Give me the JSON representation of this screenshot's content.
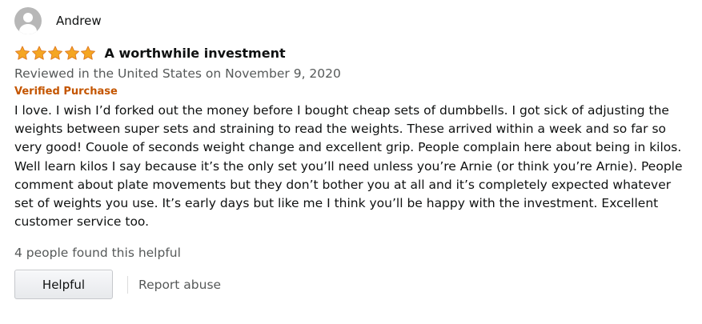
{
  "profile": {
    "name": "Andrew"
  },
  "review": {
    "rating": 5,
    "max_rating": 5,
    "star_color": "#f5a623",
    "title": "A worthwhile investment",
    "date": "Reviewed in the United States on November 9, 2020",
    "verified_label": "Verified Purchase",
    "body_lines": [
      "I love. I wish I’d forked out the money before I bought cheap sets of dumbbells. I got sick of adjusting the",
      "weights between super sets and straining to read the weights. These arrived within a week and so far so",
      "very good! Couole of seconds weight change and excellent grip. People complain here about being in kilos.",
      "Well learn kilos I say because it’s the only set you’ll need unless you’re Arnie (or think you’re Arnie). People",
      "comment about plate movements but they don’t bother you at all and it’s completely expected whatever",
      "set of weights you use. It’s early days but like me I think you’ll be happy with the investment. Excellent",
      "customer service too."
    ],
    "helpful_count_text": "4 people found this helpful"
  },
  "actions": {
    "helpful_label": "Helpful",
    "report_label": "Report abuse"
  }
}
